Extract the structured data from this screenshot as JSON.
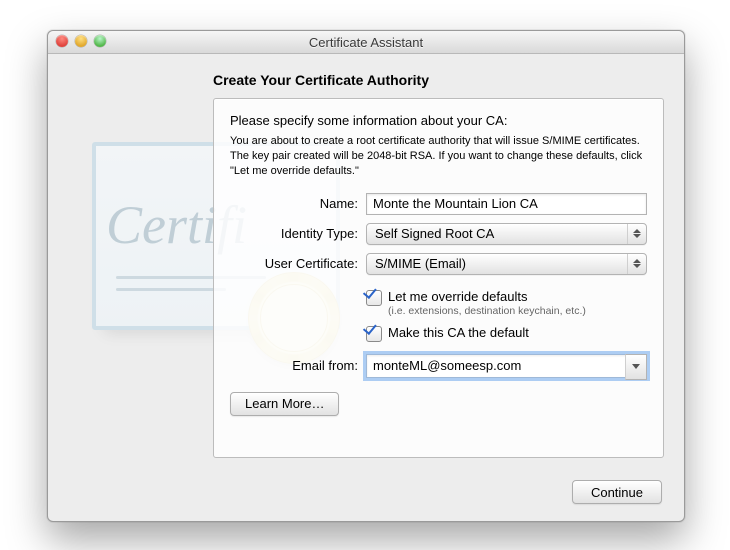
{
  "window": {
    "title": "Certificate Assistant"
  },
  "heading": "Create Your Certificate Authority",
  "panel": {
    "lead": "Please specify some information about your CA:",
    "desc": "You are about to create a root certificate authority that will issue S/MIME certificates. The key pair created will be 2048-bit RSA. If you want to change these defaults, click \"Let me override defaults.\"",
    "fields": {
      "name": {
        "label": "Name:",
        "value": "Monte the Mountain Lion CA"
      },
      "identity_type": {
        "label": "Identity Type:",
        "value": "Self Signed Root CA"
      },
      "user_cert": {
        "label": "User Certificate:",
        "value": "S/MIME (Email)"
      },
      "override": {
        "label": "Let me override defaults",
        "sub": "(i.e. extensions, destination keychain, etc.)",
        "checked": true
      },
      "make_default": {
        "label": "Make this CA the default",
        "checked": true
      },
      "email_from": {
        "label": "Email from:",
        "value": "monteML@someesp.com"
      }
    },
    "learn_more": "Learn More…"
  },
  "buttons": {
    "continue": "Continue"
  },
  "art": {
    "watermark_text": "Certifi"
  }
}
